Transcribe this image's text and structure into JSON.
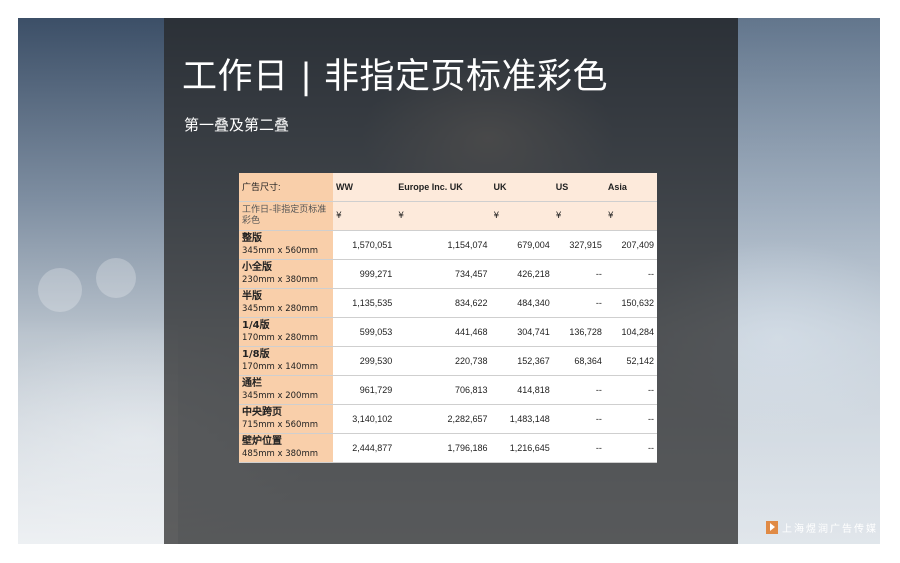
{
  "slide": {
    "title": "工作日 | 非指定页标准彩色",
    "subtitle": "第一叠及第二叠"
  },
  "table": {
    "header_label": "广告尺寸:",
    "columns": [
      "WW",
      "Europe Inc. UK",
      "UK",
      "US",
      "Asia"
    ],
    "currency_label": "工作日-非指定页标准彩色",
    "currency_symbol": "¥",
    "rows": [
      {
        "name": "整版",
        "size": "345mm x 560mm",
        "values": [
          "1,570,051",
          "1,154,074",
          "679,004",
          "327,915",
          "207,409"
        ]
      },
      {
        "name": "小全版",
        "size": "230mm x 380mm",
        "values": [
          "999,271",
          "734,457",
          "426,218",
          "--",
          "--"
        ]
      },
      {
        "name": "半版",
        "size": "345mm x 280mm",
        "values": [
          "1,135,535",
          "834,622",
          "484,340",
          "--",
          "150,632"
        ]
      },
      {
        "name": "1/4版",
        "size": "170mm x 280mm",
        "values": [
          "599,053",
          "441,468",
          "304,741",
          "136,728",
          "104,284"
        ]
      },
      {
        "name": "1/8版",
        "size": "170mm x 140mm",
        "values": [
          "299,530",
          "220,738",
          "152,367",
          "68,364",
          "52,142"
        ]
      },
      {
        "name": "通栏",
        "size": "345mm x 200mm",
        "values": [
          "961,729",
          "706,813",
          "414,818",
          "--",
          "--"
        ]
      },
      {
        "name": "中央跨页",
        "size": "715mm x 560mm",
        "values": [
          "3,140,102",
          "2,282,657",
          "1,483,148",
          "--",
          "--"
        ]
      },
      {
        "name": "壁炉位置",
        "size": "485mm x 380mm",
        "values": [
          "2,444,877",
          "1,796,186",
          "1,216,645",
          "--",
          "--"
        ]
      }
    ]
  },
  "logo": {
    "text": "上海煜润广告传媒",
    "icon": "play-mark-icon",
    "color": "#e08a45"
  },
  "colors": {
    "label_cell": "#f9cfaa",
    "header_cell": "#fdeadb",
    "overlay": "#262626"
  }
}
